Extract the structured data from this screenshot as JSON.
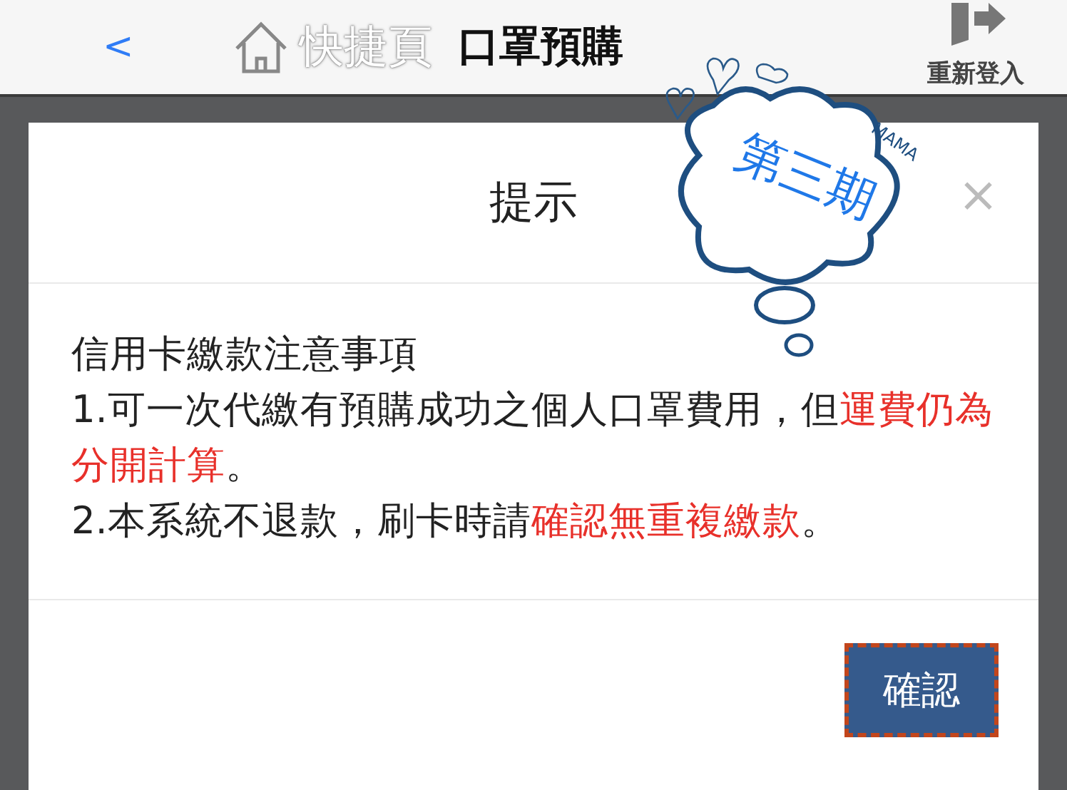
{
  "top_bar": {
    "back": "<",
    "shortcut": "快捷頁",
    "title": "口罩預購",
    "logout": "重新登入"
  },
  "dialog": {
    "title": "提示",
    "close": "×",
    "paragraphs": [
      [
        {
          "text": "信用卡繳款注意事項",
          "highlight": false
        }
      ],
      [
        {
          "text": "1.可一次代繳有預購成功之個人口罩費用，但",
          "highlight": false
        },
        {
          "text": "運費仍為分開計算",
          "highlight": true
        },
        {
          "text": "。",
          "highlight": false
        }
      ],
      [
        {
          "text": "2.本系統不退款，刷卡時請",
          "highlight": false
        },
        {
          "text": "確認無重複繳款",
          "highlight": true
        },
        {
          "text": "。",
          "highlight": false
        }
      ]
    ],
    "button": "確認"
  },
  "sticker": {
    "label": "第三期",
    "signature": "MAMA"
  }
}
